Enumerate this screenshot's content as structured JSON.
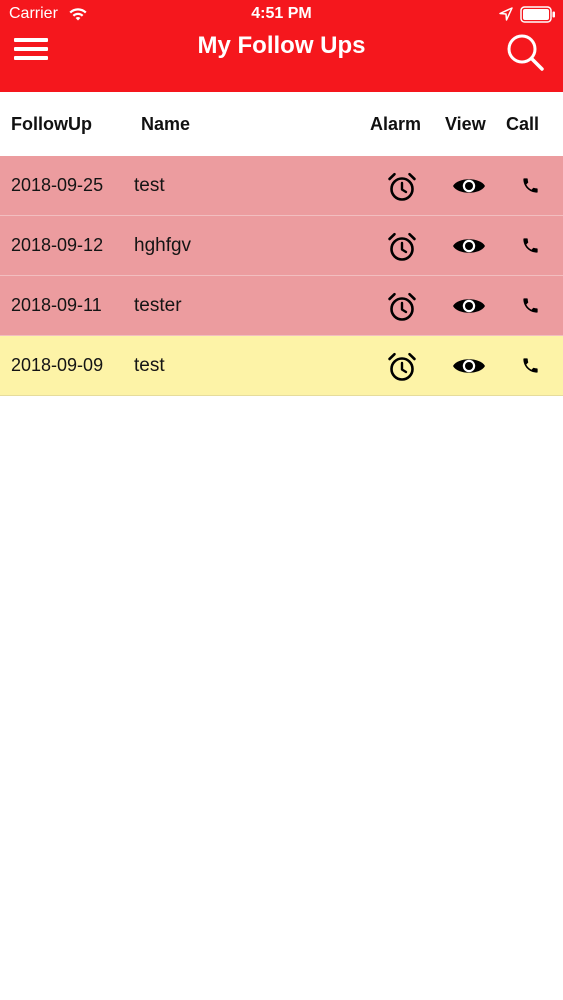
{
  "status_bar": {
    "carrier": "Carrier",
    "time": "4:51 PM"
  },
  "nav": {
    "title": "My Follow Ups",
    "menu_icon": "hamburger-menu-icon",
    "search_icon": "search-icon"
  },
  "columns": {
    "followup": "FollowUp",
    "name": "Name",
    "alarm": "Alarm",
    "view": "View",
    "call": "Call"
  },
  "rows": [
    {
      "date": "2018-09-25",
      "name": "test",
      "status": "overdue"
    },
    {
      "date": "2018-09-12",
      "name": "hghfgv",
      "status": "overdue"
    },
    {
      "date": "2018-09-11",
      "name": "tester",
      "status": "overdue"
    },
    {
      "date": "2018-09-09",
      "name": "test",
      "status": "upcoming"
    }
  ],
  "colors": {
    "header": "#f5171d",
    "overdue_row": "#ec9c9f",
    "upcoming_row": "#fdf3a7"
  }
}
